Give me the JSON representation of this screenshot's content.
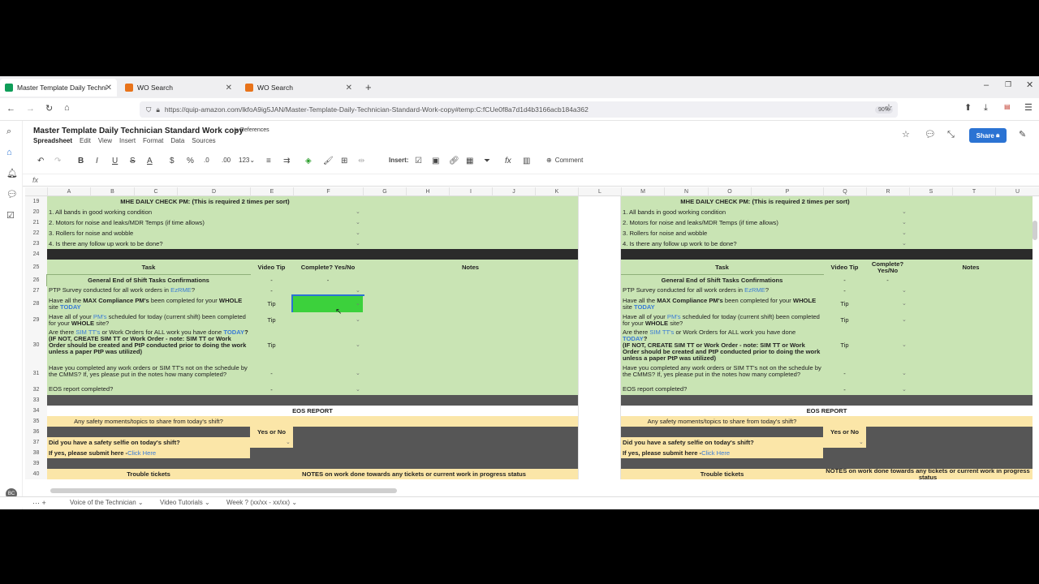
{
  "browser": {
    "tabs": [
      {
        "title": "Master Template Daily Technicia",
        "color": "#0f9d58"
      },
      {
        "title": "WO Search",
        "color": "#e8731a"
      },
      {
        "title": "WO Search",
        "color": "#e8731a"
      }
    ],
    "url": "https://quip-amazon.com/lkfoA9ig5JAN/Master-Template-Daily-Technician-Standard-Work-copy#temp:C:fCUe0f8a7d1d4b3166acb184a362",
    "zoom": "90%"
  },
  "doc": {
    "title": "Master Template Daily Technician Standard Work copy",
    "references": "References",
    "menu": [
      "Spreadsheet",
      "Edit",
      "View",
      "Insert",
      "Format",
      "Data",
      "Sources"
    ],
    "share_label": "Share",
    "insert_label": "Insert:",
    "comment_label": "Comment",
    "fx_label": "fx",
    "avatar": "BC"
  },
  "columns_left": [
    "A",
    "B",
    "C",
    "D",
    "E",
    "F",
    "G",
    "H",
    "I",
    "J",
    "K",
    "L"
  ],
  "columns_right": [
    "M",
    "N",
    "O",
    "P",
    "Q",
    "R",
    "S",
    "T",
    "U"
  ],
  "rows": [
    "19",
    "20",
    "21",
    "22",
    "23",
    "24",
    "25",
    "26",
    "27",
    "28",
    "29",
    "30",
    "31",
    "32",
    "33",
    "34",
    "35",
    "36",
    "37",
    "38",
    "39",
    "40"
  ],
  "sheet": {
    "mhe_header": "MHE DAILY CHECK PM: (This is required 2 times per sort)",
    "mhe_items": [
      "1. All bands in good working condition",
      "2. Motors for noise and leaks/MDR Temps (if time allows)",
      "3. Rollers for noise and wobble",
      "4. Is there any follow up work to be done?"
    ],
    "task_header": "Task",
    "video_tip_header": "Video Tip",
    "complete_header": "Complete? Yes/No",
    "notes_header": "Notes",
    "general_eos": "General End of Shift Tasks Confirmations",
    "dash": "-",
    "tip": "Tip",
    "tasks": {
      "ptp_pre": "PTP Survey conducted for all work orders in ",
      "ptp_link": "EzRME",
      "ptp_post": "?",
      "max_1": "Have all the ",
      "max_bold": "MAX Compliance PM's",
      "max_2": " been completed for your ",
      "max_whole": "WHOLE",
      "max_site": " site ",
      "max_today": "TODAY",
      "pm_1": "Have all of your ",
      "pm_link": "PM's",
      "pm_2": " scheduled for today (current shift) been completed for your ",
      "pm_whole": "WHOLE",
      "pm_site": " site?",
      "sim_1": "Are there ",
      "sim_link": "SIM TT's",
      "sim_2": " or Work Orders for ALL work you have done ",
      "sim_today": "TODAY",
      "sim_q": "?",
      "sim_bold": "(IF NOT, CREATE SIM TT or Work Order - note: SIM TT or Work Order should be created and PtP conducted prior to doing the work unless a paper PtP was utilized)",
      "cmms": "Have you completed any work orders or SIM TT's not on the schedule by the CMMS? If, yes please put in the notes how many completed?",
      "eos_done": "EOS report completed?"
    },
    "eos_report": "EOS REPORT",
    "safety_q": "Any safety moments/topics to share from today's shift?",
    "yes_or_no": "Yes or No",
    "selfie_q": "Did you have a safety selfie on today's shift?",
    "submit_pre": "If yes, please submit here -",
    "submit_link": "Click Here",
    "trouble": "Trouble tickets",
    "notes_work": "NOTES on work done towards any tickets or current work in progress status"
  },
  "sheet_tabs": [
    "Voice of the Technician",
    "Video Tutorials",
    "Week ? (xx/xx - xx/xx)"
  ]
}
